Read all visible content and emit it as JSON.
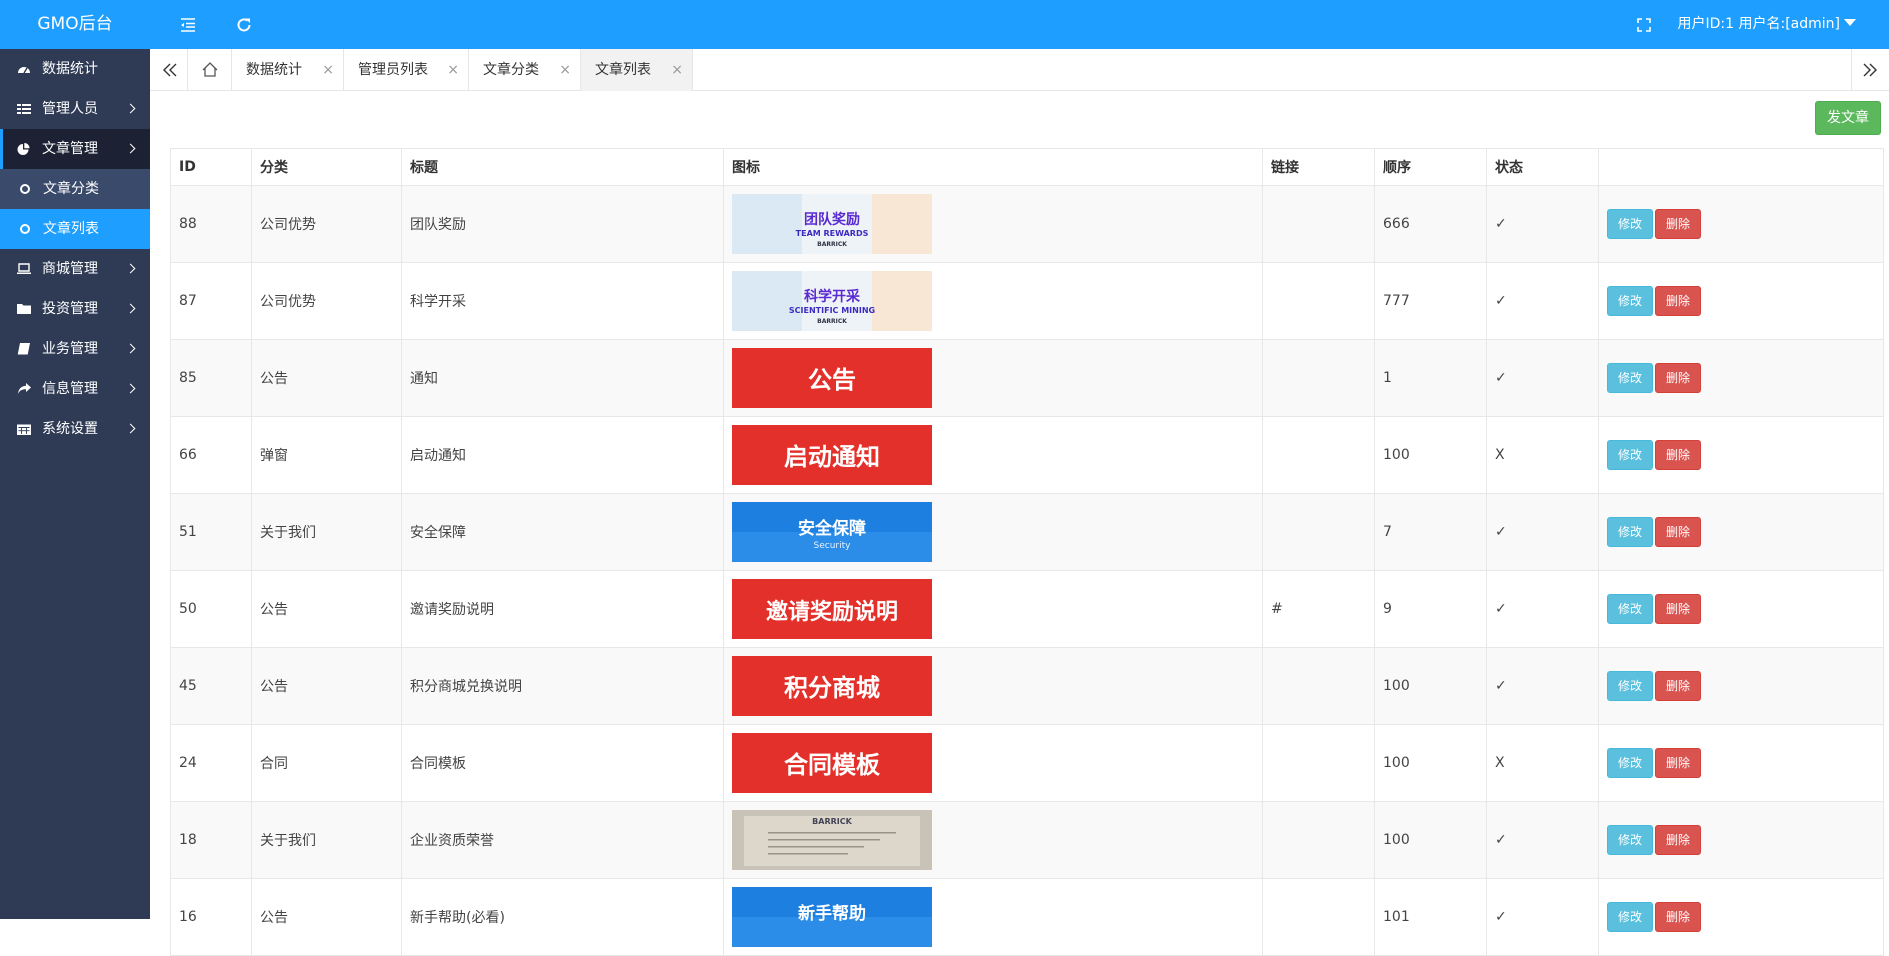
{
  "app": {
    "title": "GMO后台"
  },
  "header": {
    "user_info": "用户ID:1 用户名:[admin]"
  },
  "sidebar": {
    "items": [
      {
        "label": "数据统计",
        "icon": "dashboard-icon"
      },
      {
        "label": "管理人员",
        "icon": "grid-icon"
      },
      {
        "label": "文章管理",
        "icon": "pie-chart-icon"
      },
      {
        "label": "文章分类",
        "icon": "circle-icon"
      },
      {
        "label": "文章列表",
        "icon": "circle-icon"
      },
      {
        "label": "商城管理",
        "icon": "laptop-icon"
      },
      {
        "label": "投资管理",
        "icon": "folder-icon"
      },
      {
        "label": "业务管理",
        "icon": "book-icon"
      },
      {
        "label": "信息管理",
        "icon": "share-icon"
      },
      {
        "label": "系统设置",
        "icon": "calendar-icon"
      }
    ]
  },
  "tabs": [
    {
      "label": "数据统计"
    },
    {
      "label": "管理员列表"
    },
    {
      "label": "文章分类"
    },
    {
      "label": "文章列表"
    }
  ],
  "tab_close": "×",
  "toolbar": {
    "publish_label": "发文章"
  },
  "table": {
    "headers": [
      "ID",
      "分类",
      "标题",
      "图标",
      "链接",
      "顺序",
      "状态",
      ""
    ],
    "rows": [
      {
        "id": "88",
        "category": "公司优势",
        "title": "团队奖励",
        "icon": {
          "style": "light",
          "main": "团队奖励",
          "sub": "TEAM REWARDS",
          "brand": "BARRICK"
        },
        "link": "",
        "order": "666",
        "status": "✓"
      },
      {
        "id": "87",
        "category": "公司优势",
        "title": "科学开采",
        "icon": {
          "style": "light",
          "main": "科学开采",
          "sub": "SCIENTIFIC MINING",
          "brand": "BARRICK"
        },
        "link": "",
        "order": "777",
        "status": "✓"
      },
      {
        "id": "85",
        "category": "公告",
        "title": "通知",
        "icon": {
          "style": "red",
          "main": "公告"
        },
        "link": "",
        "order": "1",
        "status": "✓"
      },
      {
        "id": "66",
        "category": "弹窗",
        "title": "启动通知",
        "icon": {
          "style": "red",
          "main": "启动通知"
        },
        "link": "",
        "order": "100",
        "status": "X"
      },
      {
        "id": "51",
        "category": "关于我们",
        "title": "安全保障",
        "icon": {
          "style": "blue",
          "main": "安全保障",
          "sub": "Security"
        },
        "link": "",
        "order": "7",
        "status": "✓"
      },
      {
        "id": "50",
        "category": "公告",
        "title": "邀请奖励说明",
        "icon": {
          "style": "red",
          "main": "邀请奖励说明"
        },
        "link": "#",
        "order": "9",
        "status": "✓"
      },
      {
        "id": "45",
        "category": "公告",
        "title": "积分商城兑换说明",
        "icon": {
          "style": "red",
          "main": "积分商城"
        },
        "link": "",
        "order": "100",
        "status": "✓"
      },
      {
        "id": "24",
        "category": "合同",
        "title": "合同模板",
        "icon": {
          "style": "red",
          "main": "合同模板"
        },
        "link": "",
        "order": "100",
        "status": "X"
      },
      {
        "id": "18",
        "category": "关于我们",
        "title": "企业资质荣誉",
        "icon": {
          "style": "certificate",
          "brand": "BARRICK"
        },
        "link": "",
        "order": "100",
        "status": "✓"
      },
      {
        "id": "16",
        "category": "公告",
        "title": "新手帮助(必看)",
        "icon": {
          "style": "blue",
          "main": "新手帮助"
        },
        "link": "",
        "order": "101",
        "status": "✓"
      }
    ],
    "edit_label": "修改",
    "delete_label": "删除"
  }
}
